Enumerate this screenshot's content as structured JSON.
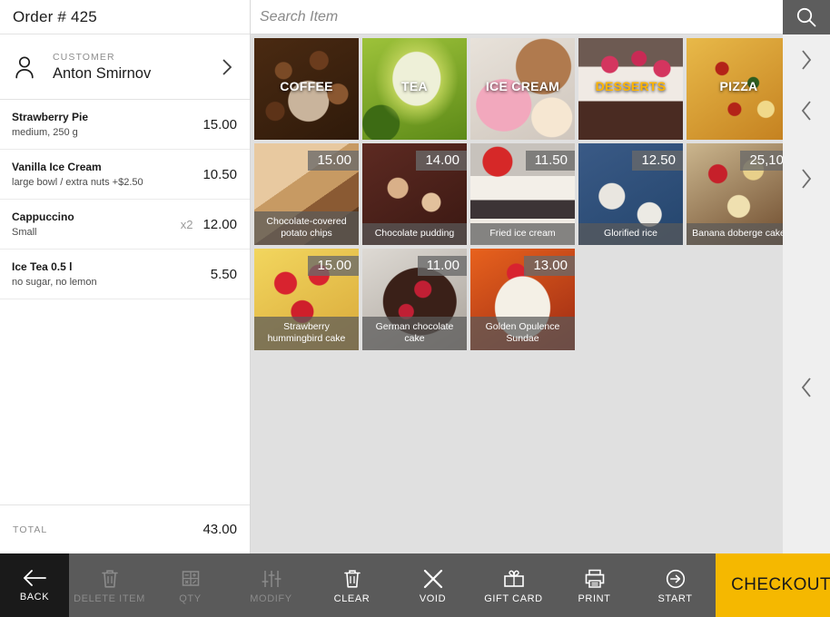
{
  "order": {
    "title": "Order  # 425",
    "customer_label": "CUSTOMER",
    "customer_name": "Anton Smirnov",
    "items": [
      {
        "name": "Strawberry Pie",
        "desc": "medium, 250 g",
        "qty": "",
        "price": "15.00"
      },
      {
        "name": "Vanilla Ice Cream",
        "desc": "large bowl / extra nuts +$2.50",
        "qty": "",
        "price": "10.50"
      },
      {
        "name": "Cappuccino",
        "desc": "Small",
        "qty": "x2",
        "price": "12.00"
      },
      {
        "name": "Ice Tea 0.5 l",
        "desc": "no sugar, no lemon",
        "qty": "",
        "price": "5.50"
      }
    ],
    "total_label": "TOTAL",
    "total_value": "43.00"
  },
  "search": {
    "placeholder": "Search Item",
    "value": ""
  },
  "categories": [
    {
      "label": "COFFEE",
      "selected": false
    },
    {
      "label": "TEA",
      "selected": false
    },
    {
      "label": "ICE CREAM",
      "selected": false
    },
    {
      "label": "DESSERTS",
      "selected": true
    },
    {
      "label": "PIZZA",
      "selected": false
    }
  ],
  "products": [
    {
      "name": "Chocolate-covered potato chips",
      "price": "15.00"
    },
    {
      "name": "Chocolate pudding",
      "price": "14.00"
    },
    {
      "name": "Fried ice cream",
      "price": "11.50"
    },
    {
      "name": "Glorified rice",
      "price": "12.50"
    },
    {
      "name": "Banana doberge cake",
      "price": "25,10"
    },
    {
      "name": "Strawberry hummingbird cake",
      "price": "15.00"
    },
    {
      "name": "German chocolate cake",
      "price": "11.00"
    },
    {
      "name": "Golden Opulence Sundae",
      "price": "13.00"
    }
  ],
  "toolbar": {
    "back": "BACK",
    "delete_item": "DELETE ITEM",
    "qty": "QTY",
    "modify": "MODIFY",
    "clear": "CLEAR",
    "void": "VOID",
    "gift_card": "GIFT CARD",
    "print": "PRINT",
    "start": "START",
    "checkout": "CHECKOUT"
  },
  "colors": {
    "accent": "#f5b800",
    "selected_border": "#f0a800",
    "selected_text": "#ffb500",
    "toolbar_bg": "#5a5a5a",
    "back_bg": "#1a1a1a",
    "content_bg": "#e0e0e0"
  }
}
